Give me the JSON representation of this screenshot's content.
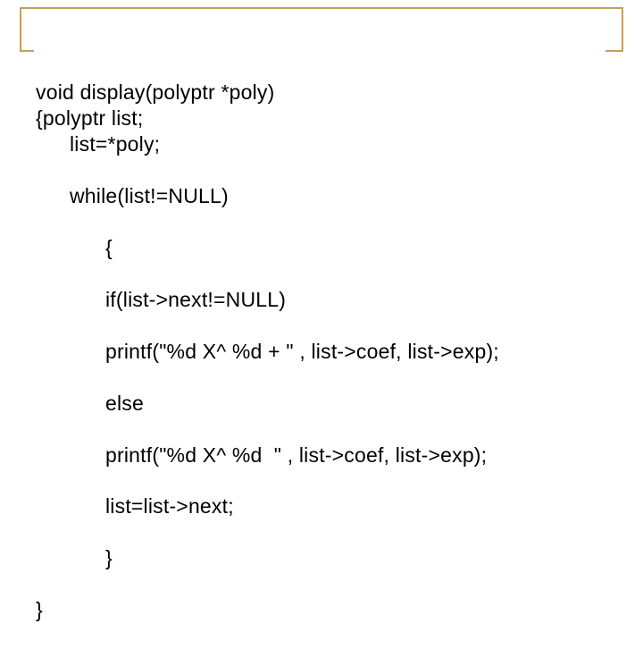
{
  "code": {
    "l1": "void display(polyptr *poly)",
    "l2": "{polyptr list;",
    "l3": "list=*poly;",
    "l4": "while(list!=NULL)",
    "l5": "{",
    "l6": "if(list->next!=NULL)",
    "l7": "printf(\"%d X^ %d + \" , list->coef, list->exp);",
    "l8": "else",
    "l9": "printf(\"%d X^ %d  \" , list->coef, list->exp);",
    "l10": "list=list->next;",
    "l11": "}",
    "l12": "}"
  }
}
